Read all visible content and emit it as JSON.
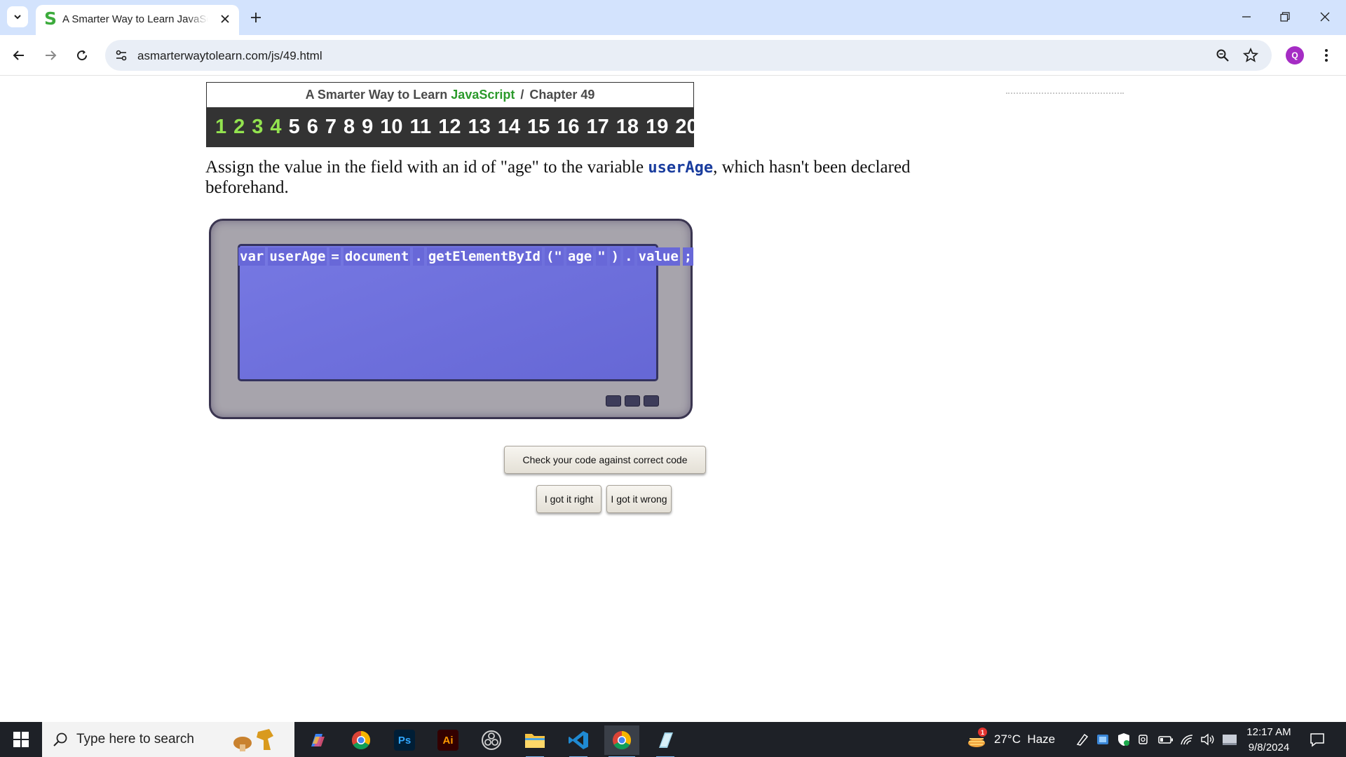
{
  "browser": {
    "tab_title": "A Smarter Way to Learn JavaScript",
    "favicon_letter": "S",
    "url": "asmarterwaytolearn.com/js/49.html",
    "profile_initial": "Q"
  },
  "page": {
    "header": {
      "prefix": "A Smarter Way to Learn ",
      "brand": "JavaScript",
      "separator": "/",
      "chapter": "Chapter 49"
    },
    "chapter_nav": [
      {
        "label": "1",
        "done": true
      },
      {
        "label": "2",
        "done": true
      },
      {
        "label": "3",
        "done": true
      },
      {
        "label": "4",
        "done": true
      },
      {
        "label": "5",
        "done": false
      },
      {
        "label": "6",
        "done": false
      },
      {
        "label": "7",
        "done": false
      },
      {
        "label": "8",
        "done": false
      },
      {
        "label": "9",
        "done": false
      },
      {
        "label": "10",
        "done": false
      },
      {
        "label": "11",
        "done": false
      },
      {
        "label": "12",
        "done": false
      },
      {
        "label": "13",
        "done": false
      },
      {
        "label": "14",
        "done": false
      },
      {
        "label": "15",
        "done": false
      },
      {
        "label": "16",
        "done": false
      },
      {
        "label": "17",
        "done": false
      },
      {
        "label": "18",
        "done": false
      },
      {
        "label": "19",
        "done": false
      },
      {
        "label": "20",
        "done": false
      }
    ],
    "instruction": {
      "before": "Assign the value in the field with an id of \"age\" to the variable ",
      "variable": "userAge",
      "after": ", which hasn't been declared beforehand."
    },
    "code_tokens": [
      "var",
      "userAge",
      "=",
      "document",
      ".",
      "getElementById",
      "(\"",
      "age",
      "\"",
      ")",
      ".",
      "value",
      ";"
    ],
    "buttons": {
      "check": "Check your code against correct code",
      "right": "I got it right",
      "wrong": "I got it wrong"
    }
  },
  "taskbar": {
    "search_placeholder": "Type here to search",
    "weather": "27°C  Haze",
    "weather_badge": "1",
    "time": "12:17 AM",
    "date": "9/8/2024",
    "apps": [
      "copilot-icon",
      "chrome-icon",
      "photoshop-icon",
      "illustrator-icon",
      "obs-icon",
      "file-explorer-icon",
      "vscode-icon",
      "chrome-active-icon",
      "notepad-icon"
    ],
    "ps_label": "Ps",
    "ai_label": "Ai"
  },
  "colors": {
    "brand_green": "#2b9a2b",
    "done_chapter": "#93e34f",
    "screen_blue": "#6f71e1",
    "code_variable": "#1a3d9e"
  }
}
